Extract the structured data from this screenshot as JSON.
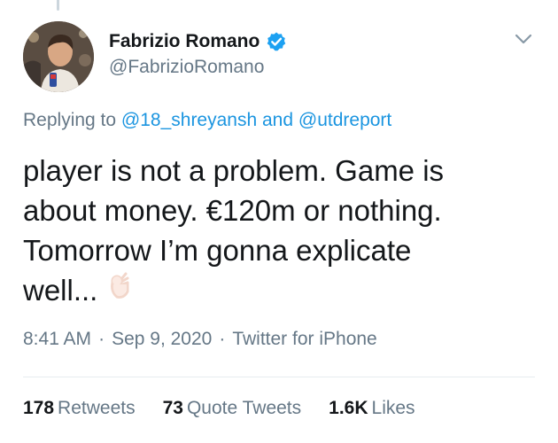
{
  "user": {
    "display_name": "Fabrizio Romano",
    "handle": "@FabrizioRomano",
    "verified": true,
    "avatar_icon": "profile-photo"
  },
  "reply": {
    "prefix": "Replying to",
    "mention_1": "@18_shreyansh",
    "conjunction": "and",
    "mention_2": "@utdreport"
  },
  "tweet": {
    "lines": [
      "player is not a problem. Game is",
      "about money. €120m or nothing.",
      "Tomorrow I’m gonna explicate",
      "well..."
    ],
    "emoji": "👌"
  },
  "meta": {
    "time": "8:41 AM",
    "separator": "·",
    "date": "Sep 9, 2020",
    "source": "Twitter for iPhone"
  },
  "stats": {
    "retweets_count": "178",
    "retweets_label": "Retweets",
    "quotes_count": "73",
    "quotes_label": "Quote Tweets",
    "likes_count": "1.6K",
    "likes_label": "Likes"
  },
  "colors": {
    "text": "#14171a",
    "secondary": "#657786",
    "link": "#1b95e0",
    "verified": "#1da1f2",
    "divider": "#e6ecf0"
  }
}
